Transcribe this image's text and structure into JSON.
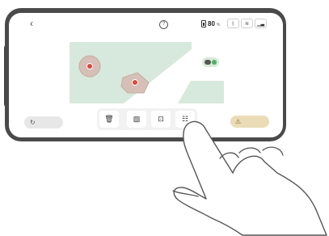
{
  "status_bar": {
    "back_icon": "chevron-left-icon",
    "back_glyph": "‹",
    "help_icon": "question-circle-icon",
    "help_glyph": "?",
    "battery_icon": "battery-icon",
    "battery_percent": "80",
    "battery_unit": "%",
    "connectivity": [
      {
        "icon": "bluetooth-icon",
        "glyph": "ᛒ"
      },
      {
        "icon": "wifi-icon",
        "glyph": "≋"
      },
      {
        "icon": "cellular-signal-icon",
        "glyph": "▁▃"
      }
    ]
  },
  "map": {
    "lawn_color": "#d7e9dc",
    "zone_color": "#d5bfb7",
    "zone_border_color": "#c6ad9f",
    "marker_color": "#e0463c",
    "robot": {
      "icon": "robot-mower-icon",
      "status_color": "#4caf6a"
    }
  },
  "actions": {
    "left": {
      "icon": "refresh-icon",
      "glyph": "↻",
      "color": "#e7e7e7"
    },
    "right": {
      "icon": "warning-icon",
      "glyph": "⚠",
      "color": "#eadcb7"
    }
  },
  "toolbar": {
    "items": [
      {
        "icon": "trash-icon",
        "glyph": "🗑"
      },
      {
        "icon": "no-go-zone-icon",
        "glyph": "▧"
      },
      {
        "icon": "zone-edit-icon",
        "glyph": "⊡"
      },
      {
        "icon": "channel-path-icon",
        "glyph": "☷"
      }
    ]
  },
  "colors": {
    "phone_frame": "#4a4a4a",
    "screen_bg": "#ffffff",
    "hand_outline": "#555555"
  }
}
